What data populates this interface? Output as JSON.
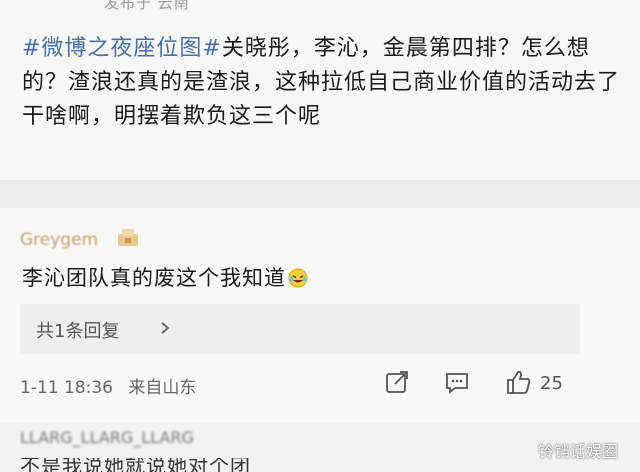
{
  "post": {
    "meta": "发布于 云南",
    "hashtag": "#微博之夜座位图#",
    "text": "关晓彤，李沁，金晨第四排？怎么想的？渣浪还真的是渣浪，这种拉低自己商业价值的活动去了干啥啊，明摆着欺负这三个呢"
  },
  "comment": {
    "username": "Greygem",
    "text": "李沁团队真的废这个我知道",
    "emoji": "laughing-tears-icon",
    "replies_label": "共1条回复",
    "timestamp": "1-11 18:36",
    "source": "来自山东",
    "likes": "25"
  },
  "next_comment": {
    "username": "LLARG_LLARG_LLARG",
    "text_partial": "不是我说她就说她对个团"
  },
  "watermark": "铃铛话娱圈",
  "colors": {
    "hashtag": "#4a6fa0",
    "username": "#c7a06a",
    "background": "#f2f2f2"
  }
}
